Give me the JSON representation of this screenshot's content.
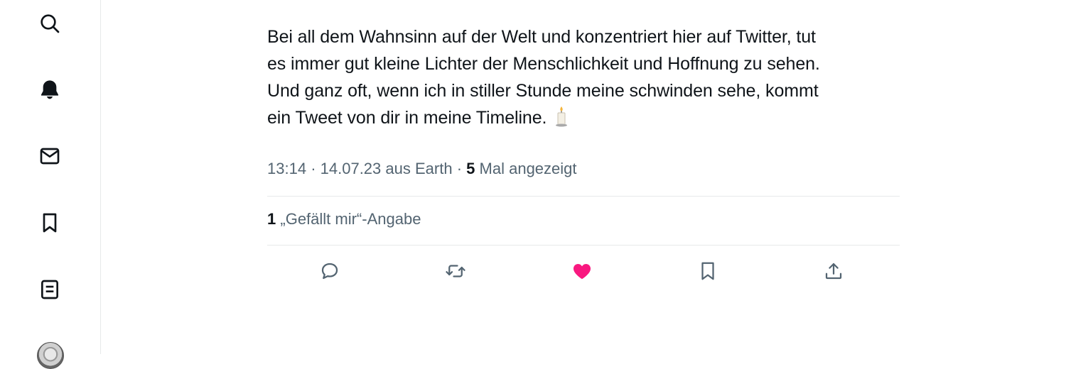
{
  "sidebar": {
    "items": [
      {
        "icon": "search-icon",
        "label": "Search"
      },
      {
        "icon": "bell-icon",
        "label": "Notifications"
      },
      {
        "icon": "mail-icon",
        "label": "Messages"
      },
      {
        "icon": "bookmark-icon",
        "label": "Bookmarks"
      },
      {
        "icon": "lists-icon",
        "label": "Lists"
      }
    ]
  },
  "tweet": {
    "text_line_1": "Bei all dem Wahnsinn auf der Welt und konzentriert hier auf Twitter, tut",
    "text_line_2": "es immer gut kleine Lichter der Menschlichkeit und Hoffnung zu sehen.",
    "text_line_3": "Und ganz oft, wenn ich in stiller Stunde meine schwinden sehe, kommt",
    "text_line_4": "ein Tweet von dir in meine Timeline.",
    "emoji": "candle",
    "time": "13:14",
    "date": "14.07.23",
    "source": "aus Earth",
    "separator": "·",
    "views_count": "5",
    "views_label": "Mal angezeigt",
    "likes_count": "1",
    "likes_label": "„Gefällt mir“-Angabe"
  },
  "actions": [
    {
      "icon": "reply-icon"
    },
    {
      "icon": "retweet-icon"
    },
    {
      "icon": "heart-icon",
      "active": true,
      "color": "#f91880"
    },
    {
      "icon": "bookmark-icon"
    },
    {
      "icon": "share-icon"
    }
  ],
  "colors": {
    "text": "#0f1419",
    "secondary": "#536471",
    "like": "#f91880",
    "border": "#e7e9ea"
  }
}
